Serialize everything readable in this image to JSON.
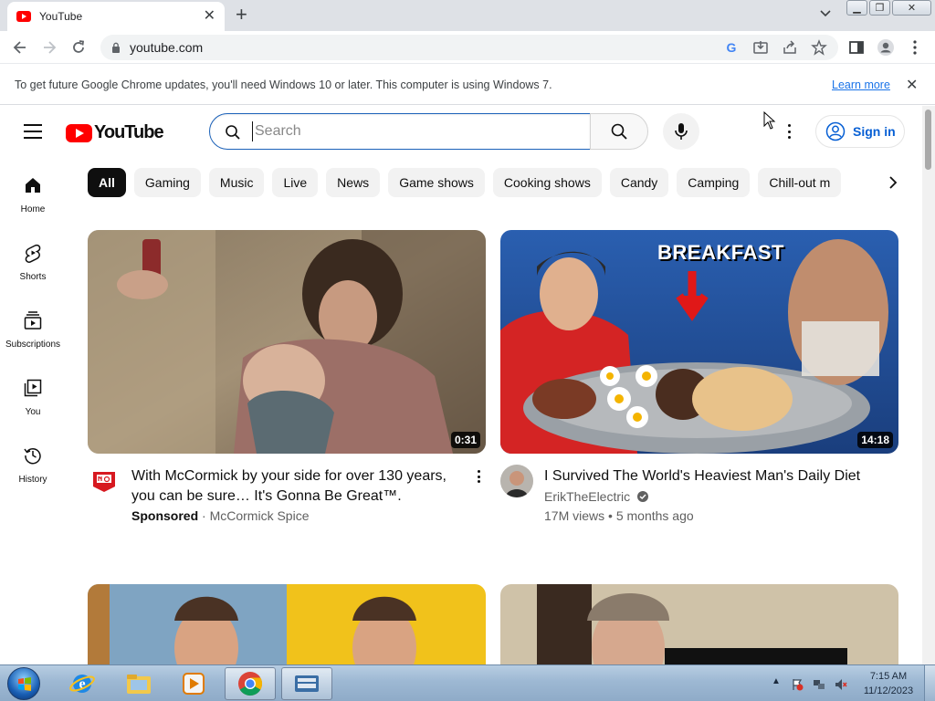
{
  "browser": {
    "tab_title": "YouTube",
    "url": "youtube.com",
    "info_bar": {
      "message": "To get future Google Chrome updates, you'll need Windows 10 or later. This computer is using Windows 7.",
      "link": "Learn more"
    }
  },
  "youtube": {
    "logo_text": "YouTube",
    "search_placeholder": "Search",
    "sign_in": "Sign in",
    "chips": [
      "All",
      "Gaming",
      "Music",
      "Live",
      "News",
      "Game shows",
      "Cooking shows",
      "Candy",
      "Camping",
      "Chill-out m"
    ],
    "sidebar": [
      {
        "label": "Home",
        "icon": "home-icon"
      },
      {
        "label": "Shorts",
        "icon": "shorts-icon"
      },
      {
        "label": "Subscriptions",
        "icon": "subscriptions-icon"
      },
      {
        "label": "You",
        "icon": "you-icon"
      },
      {
        "label": "History",
        "icon": "history-icon"
      }
    ],
    "videos": [
      {
        "title": "With McCormick by your side for over 130 years, you can be sure… It's Gonna Be Great™.",
        "sponsored": "Sponsored",
        "separator": "·",
        "channel": "McCormick Spice",
        "duration": "0:31"
      },
      {
        "title": "I Survived The World's Heaviest Man's Daily Diet",
        "channel": "ErikTheElectric",
        "views": "17M views",
        "separator": "•",
        "age": "5 months ago",
        "duration": "14:18",
        "thumb_text": "BREAKFAST"
      }
    ]
  },
  "taskbar": {
    "time": "7:15 AM",
    "date": "11/12/2023"
  },
  "colors": {
    "youtube_red": "#ff0000",
    "link_blue": "#065fd4",
    "chrome_tab_strip": "#dee1e6"
  }
}
